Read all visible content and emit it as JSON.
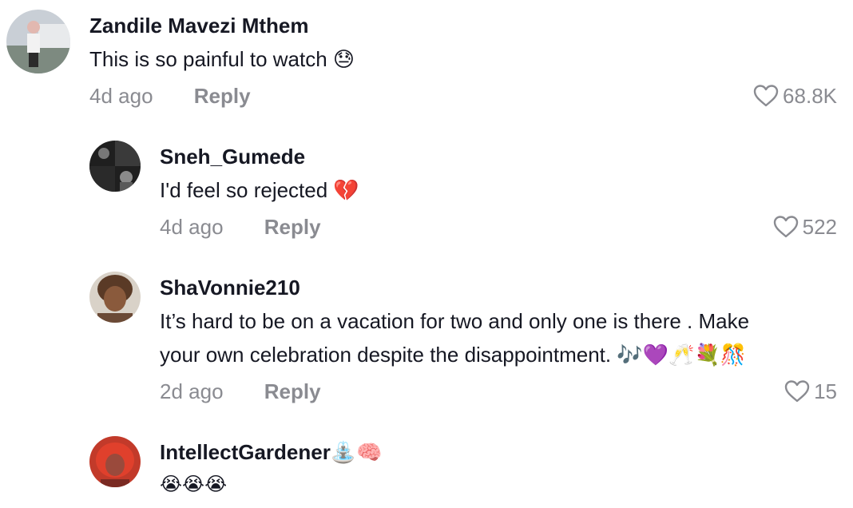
{
  "comments": [
    {
      "username": "Zandile Mavezi Mthem",
      "text": "This is so painful to watch 😓",
      "time": "4d ago",
      "reply_label": "Reply",
      "likes": "68.8K",
      "avatar_icon": "avatar-photo"
    },
    {
      "username": "Sneh_Gumede",
      "text": "I'd feel so rejected 💔",
      "time": "4d ago",
      "reply_label": "Reply",
      "likes": "522",
      "avatar_icon": "avatar-photo"
    },
    {
      "username": "ShaVonnie210",
      "text_line1": "It’s hard to be on a vacation for two and only one is there . Make",
      "text_line2": "your own celebration despite the disappointment. 🎶💜🥂💐🎊",
      "time": "2d ago",
      "reply_label": "Reply",
      "likes": "15",
      "avatar_icon": "avatar-photo"
    },
    {
      "username": "IntellectGardener⛲🧠",
      "text": "😭😭😭",
      "avatar_icon": "avatar-photo"
    }
  ],
  "colors": {
    "text": "#161823",
    "meta": "#8a8b91",
    "background": "#ffffff"
  },
  "icons": {
    "like": "heart-outline-icon"
  }
}
